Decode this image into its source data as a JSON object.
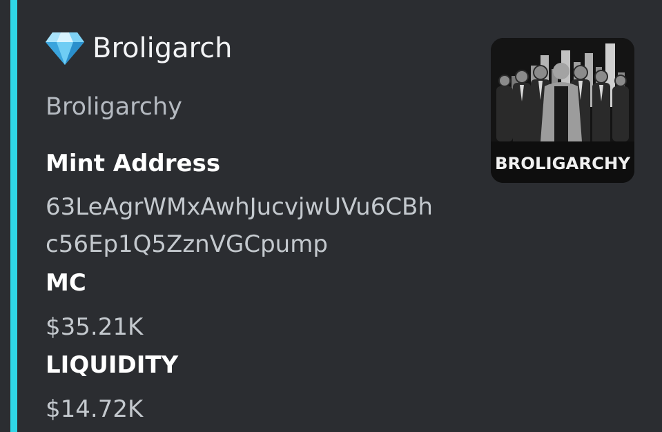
{
  "embed": {
    "accent_color": "#2fd6e6",
    "author": {
      "icon": "gem-stone-icon",
      "name": "Broligarch"
    },
    "title": "Broligarchy",
    "fields": {
      "mint_address": {
        "name": "Mint Address",
        "value_line1": "63LeAgrWMxAwhJucvjwUVu6CBh",
        "value_line2": "c56Ep1Q5ZznVGCpump"
      },
      "mc": {
        "name": "MC",
        "value": "$35.21K"
      },
      "liquidity": {
        "name": "LIQUIDITY",
        "value": "$14.72K"
      }
    },
    "thumbnail": {
      "caption": "BROLIGARCHY"
    }
  }
}
